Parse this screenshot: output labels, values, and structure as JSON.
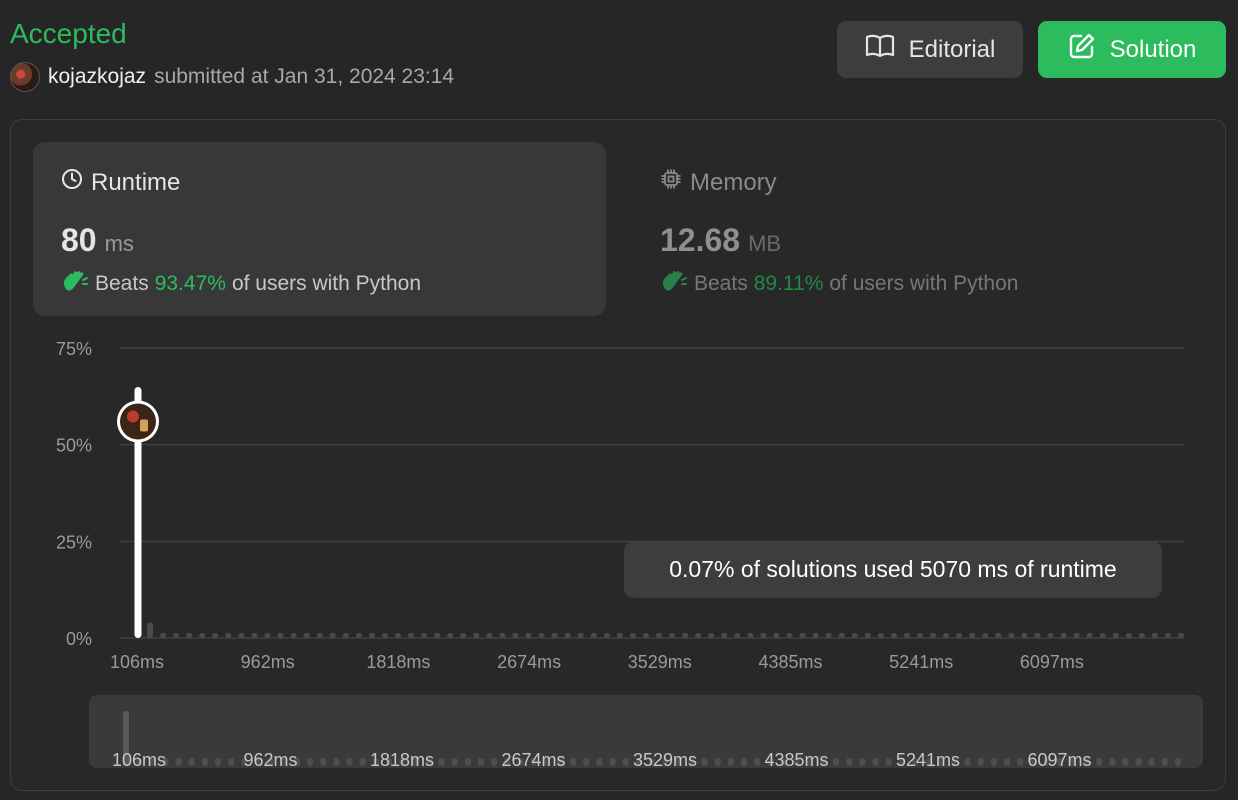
{
  "header": {
    "status": "Accepted",
    "username": "kojazkojaz",
    "submitted_text": "submitted at Jan 31, 2024 23:14",
    "editorial_label": "Editorial",
    "solution_label": "Solution",
    "accent_color": "#2cbb5d"
  },
  "runtime": {
    "title": "Runtime",
    "value": "80",
    "unit": "ms",
    "beats_label": "Beats",
    "beats_pct": "93.47%",
    "beats_tail": "of users with Python",
    "icon": "clock-icon"
  },
  "memory": {
    "title": "Memory",
    "value": "12.68",
    "unit": "MB",
    "beats_label": "Beats",
    "beats_pct": "89.11%",
    "beats_tail": "of users with Python",
    "icon": "chip-icon"
  },
  "tooltip": {
    "text": "0.07% of solutions used 5070 ms of runtime"
  },
  "chart_data": {
    "type": "bar",
    "xlabel": "",
    "ylabel": "",
    "y_ticks": [
      "75%",
      "50%",
      "25%",
      "0%"
    ],
    "ylim": [
      0,
      75
    ],
    "x_tick_labels": [
      "106ms",
      "962ms",
      "1818ms",
      "2674ms",
      "3529ms",
      "4385ms",
      "5241ms",
      "6097ms"
    ],
    "highlight": {
      "x": "80ms",
      "value": 56
    },
    "values": [
      56,
      4,
      0.5,
      0.5,
      0.5,
      0.5,
      0.5,
      0.5,
      0.5,
      0.5,
      0.5,
      0.5,
      0.5,
      0.5,
      0.5,
      0.5,
      0.5,
      0.5,
      0.5,
      0.5,
      0.5,
      0.5,
      0.5,
      0.5,
      0.5,
      0.5,
      0.5,
      0.5,
      0.5,
      0.5,
      0.5,
      0.5,
      0.5,
      0.5,
      0.5,
      0.5,
      0.5,
      0.5,
      0.5,
      0.5,
      0.5,
      0.5,
      0.5,
      0.5,
      0.5,
      0.5,
      0.5,
      0.5,
      0.5,
      0.5,
      0.5,
      0.5,
      0.5,
      0.5,
      0.5,
      0.5,
      0.5,
      0.5,
      0.5,
      0.5,
      0.5,
      0.5,
      0.5,
      0.5,
      0.5,
      0.5,
      0.5,
      0.5,
      0.5,
      0.5,
      0.5,
      0.5,
      0.5,
      0.5,
      0.5,
      0.5,
      0.5,
      0.5,
      0.5,
      0.5,
      0.5
    ],
    "grid": true,
    "colors": {
      "bar": "#4a4a4a",
      "highlight": "#ffffff",
      "grid": "#3f3f3f"
    }
  }
}
